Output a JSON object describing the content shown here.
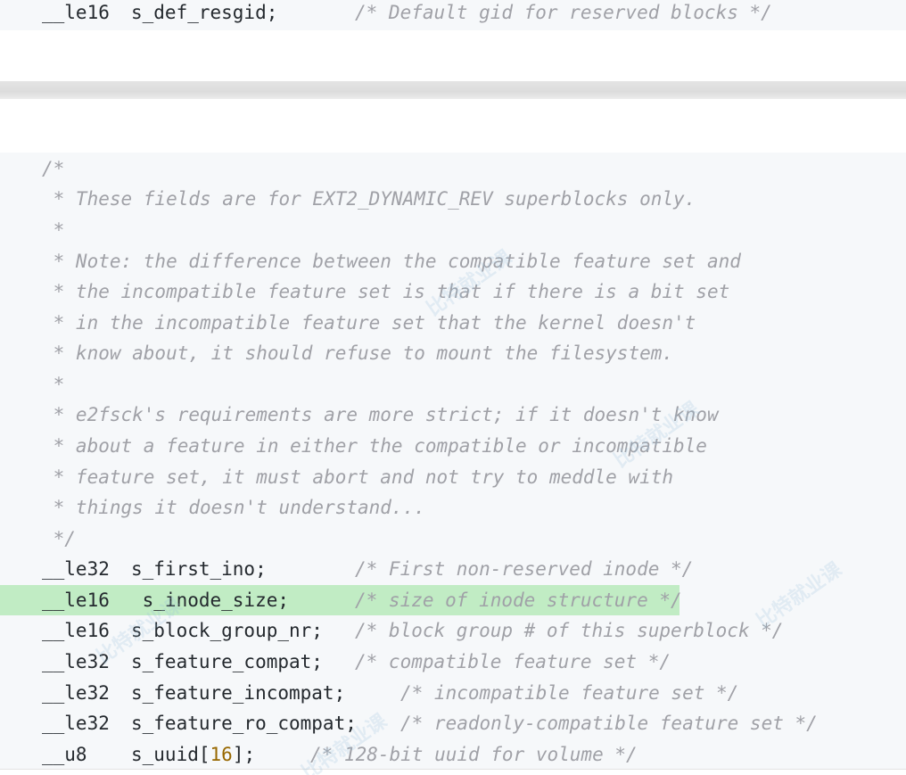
{
  "top_block": {
    "line": {
      "type": "__le16",
      "name": "s_def_resgid;",
      "comment": "/* Default gid for reserved blocks */"
    }
  },
  "comment_block": [
    "/*",
    " * These fields are for EXT2_DYNAMIC_REV superblocks only.",
    " *",
    " * Note: the difference between the compatible feature set and",
    " * the incompatible feature set is that if there is a bit set",
    " * in the incompatible feature set that the kernel doesn't",
    " * know about, it should refuse to mount the filesystem.",
    " *",
    " * e2fsck's requirements are more strict; if it doesn't know",
    " * about a feature in either the compatible or incompatible",
    " * feature set, it must abort and not try to meddle with",
    " * things it doesn't understand...",
    " */"
  ],
  "fields": [
    {
      "type": "__le32",
      "name": "s_first_ino;",
      "comment": "/* First non-reserved inode */"
    },
    {
      "type": "__le16",
      "name": " s_inode_size;",
      "comment": "/* size of inode structure */"
    },
    {
      "type": "__le16",
      "name": "s_block_group_nr;",
      "comment": "/* block group # of this superblock */"
    },
    {
      "type": "__le32",
      "name": "s_feature_compat;",
      "comment": "/* compatible feature set */"
    },
    {
      "type": "__le32",
      "name": "s_feature_incompat;",
      "comment": "/* incompatible feature set */"
    },
    {
      "type": "__le32",
      "name": "s_feature_ro_compat;",
      "comment": "/* readonly-compatible feature set */"
    },
    {
      "type": "__u8",
      "name_prefix": "s_uuid[",
      "name_num": "16",
      "name_suffix": "];",
      "comment": "/* 128-bit uuid for volume */"
    }
  ],
  "watermark": "比特就业课",
  "colors": {
    "code_background": "#f6f8fa",
    "highlight": "#c1ecc4",
    "comment": "#a0a1a7",
    "number": "#986801",
    "text": "#24292e"
  }
}
